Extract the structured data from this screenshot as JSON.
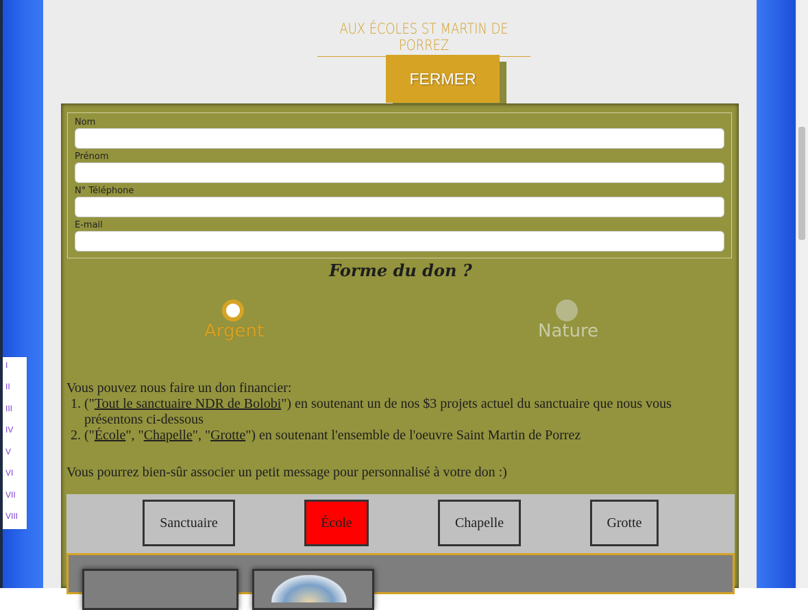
{
  "header": {
    "title": "Aux Écoles St Martin de Porrez"
  },
  "close_button": {
    "label": "FERMER"
  },
  "form": {
    "fields": [
      {
        "label": "Nom",
        "value": ""
      },
      {
        "label": "Prénom",
        "value": ""
      },
      {
        "label": "N° Téléphone",
        "value": ""
      },
      {
        "label": "E-mail",
        "value": ""
      }
    ]
  },
  "donation_form": {
    "title": "Forme du don ?",
    "options": [
      {
        "label": "Argent",
        "selected": true
      },
      {
        "label": "Nature",
        "selected": false
      }
    ]
  },
  "info": {
    "intro": "Vous pouvez nous faire un don financier:",
    "item1": {
      "pre": "(\"",
      "link": "Tout le sanctuaire NDR de Bolobi",
      "post": "\") en soutenant un de nos $3 projets actuel du sanctuaire que nous vous présentons ci-dessous"
    },
    "item2": {
      "pre": "(\"",
      "link1": "École",
      "sep1": "\", \"",
      "link2": "Chapelle",
      "sep2": "\", \"",
      "link3": "Grotte",
      "post": "\") en soutenant l'ensemble de l'oeuvre Saint Martin de Porrez"
    },
    "note": "Vous pourrez bien-sûr associer un petit message pour personnalisé à votre don :)"
  },
  "tabs": [
    {
      "label": "Sanctuaire",
      "active": false
    },
    {
      "label": "École",
      "active": true
    },
    {
      "label": "Chapelle",
      "active": false
    },
    {
      "label": "Grotte",
      "active": false
    }
  ],
  "toc": [
    "I",
    "II",
    "III",
    "IV",
    "V",
    "VI",
    "VII",
    "VIII"
  ],
  "colors": {
    "accent": "#d6a325",
    "panel": "#94943f",
    "active_tab": "#ff0000",
    "toc_link": "#7b3fd0"
  }
}
